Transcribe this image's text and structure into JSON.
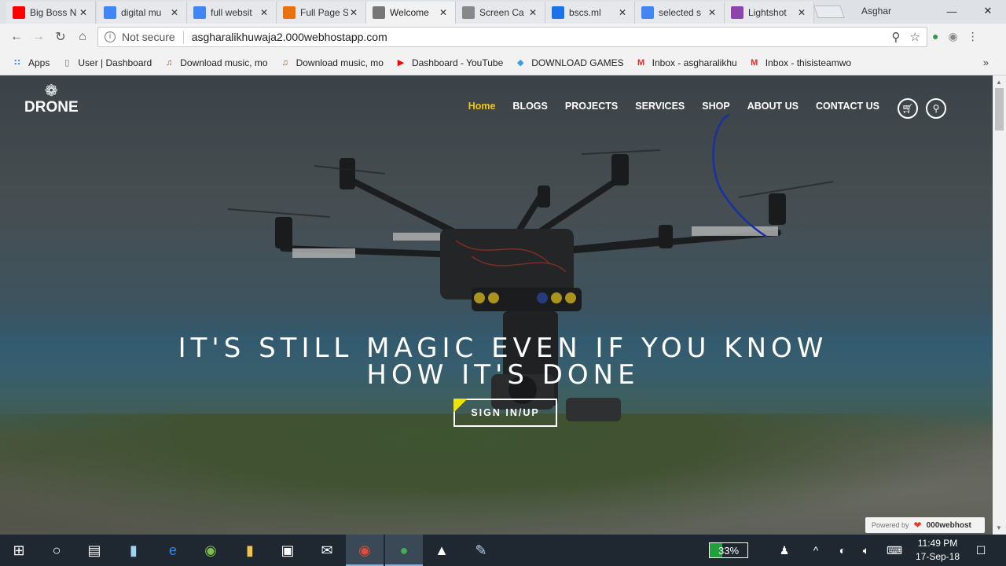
{
  "browser": {
    "tabs": [
      {
        "title": "Big Boss N",
        "icon": "youtube-icon",
        "color": "#ff0000"
      },
      {
        "title": "digital mu",
        "icon": "google-icon",
        "color": "#4285f4"
      },
      {
        "title": "full websit",
        "icon": "google-icon",
        "color": "#4285f4"
      },
      {
        "title": "Full Page S",
        "icon": "rainbow-icon",
        "color": "#e8710a"
      },
      {
        "title": "Welcome",
        "icon": "page-icon",
        "color": "#777777"
      },
      {
        "title": "Screen Ca",
        "icon": "camera-icon",
        "color": "#888888"
      },
      {
        "title": "bscs.ml",
        "icon": "fn-icon",
        "color": "#1a73e8"
      },
      {
        "title": "selected s",
        "icon": "google-icon",
        "color": "#4285f4"
      },
      {
        "title": "Lightshot",
        "icon": "feather-icon",
        "color": "#8e44ad"
      }
    ],
    "active_tab_index": 4,
    "profile_name": "Asghar",
    "security_label": "Not secure",
    "url": "asgharalikhuwaja2.000webhostapp.com"
  },
  "bookmarks": [
    {
      "label": "Apps",
      "icon": "apps-grid-icon"
    },
    {
      "label": "User | Dashboard",
      "icon": "page-icon"
    },
    {
      "label": "Download music, mo",
      "icon": "music-icon"
    },
    {
      "label": "Download music, mo",
      "icon": "music-icon"
    },
    {
      "label": "Dashboard - YouTube",
      "icon": "youtube-icon"
    },
    {
      "label": "DOWNLOAD GAMES",
      "icon": "diamond-icon"
    },
    {
      "label": "Inbox - asgharalikhu",
      "icon": "gmail-icon"
    },
    {
      "label": "Inbox - thisisteamwo",
      "icon": "gmail-icon"
    }
  ],
  "site": {
    "logo_text": "DRONE",
    "nav": [
      "Home",
      "BLOGS",
      "PROJECTS",
      "SERVICES",
      "SHOP",
      "ABOUT US",
      "CONTACT US"
    ],
    "active_nav": "Home",
    "accent_color": "#f5c518",
    "hero_line1": "IT'S STILL MAGIC EVEN IF YOU KNOW",
    "hero_line2": "HOW IT'S DONE",
    "cta_label": "SIGN IN/UP",
    "powered_label": "Powered by",
    "powered_brand": "000webhost"
  },
  "taskbar": {
    "battery_percent": "33%",
    "time": "11:49 PM",
    "date": "17-Sep-18"
  }
}
